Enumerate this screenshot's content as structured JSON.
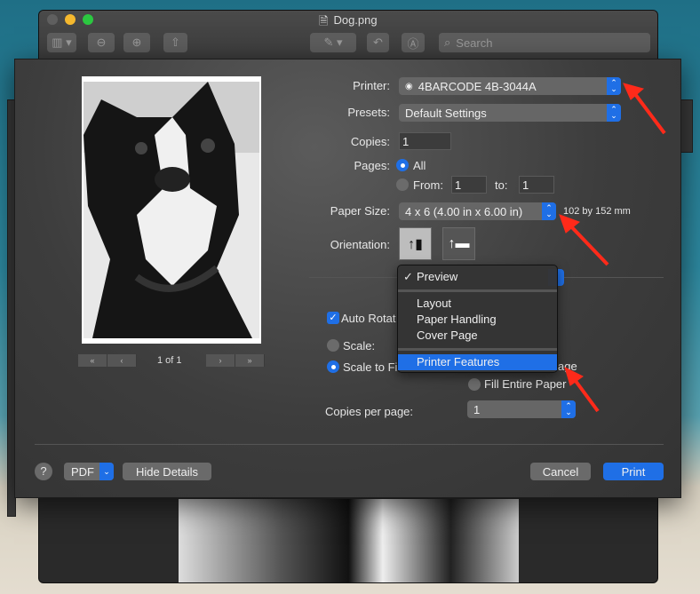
{
  "window": {
    "title": "Dog.png",
    "search_placeholder": "Search"
  },
  "colors": {
    "accent": "#1f6fe6",
    "annotation_arrow": "#ff2a1a"
  },
  "print_dialog": {
    "printer_label": "Printer:",
    "printer_value": "4BARCODE 4B-3044A",
    "presets_label": "Presets:",
    "presets_value": "Default Settings",
    "copies_label": "Copies:",
    "copies_value": "1",
    "pages_label": "Pages:",
    "pages_all": "All",
    "pages_from": "From:",
    "from_value": "1",
    "to_label": "to:",
    "to_value": "1",
    "paper_size_label": "Paper Size:",
    "paper_size_value": "4 x 6 (4.00 in x 6.00 in)",
    "paper_size_mm": "102 by 152 mm",
    "orientation_label": "Orientation:",
    "preview_page": "1 of 1",
    "auto_rotate": "Auto Rotat",
    "scale": "Scale:",
    "scale_to_fit": "Scale to Fi",
    "print_entire": "age",
    "fill_entire": "Fill Entire Paper",
    "copies_per_page_label": "Copies per page:",
    "copies_per_page_value": "1",
    "help": "?",
    "pdf": "PDF",
    "hide_details": "Hide Details",
    "cancel": "Cancel",
    "print": "Print"
  },
  "section_menu": {
    "items": [
      {
        "label": "Preview",
        "checked": true
      },
      {
        "label": "Layout"
      },
      {
        "label": "Paper Handling"
      },
      {
        "label": "Cover Page"
      },
      {
        "label": "Printer Features",
        "highlighted": true
      }
    ]
  }
}
